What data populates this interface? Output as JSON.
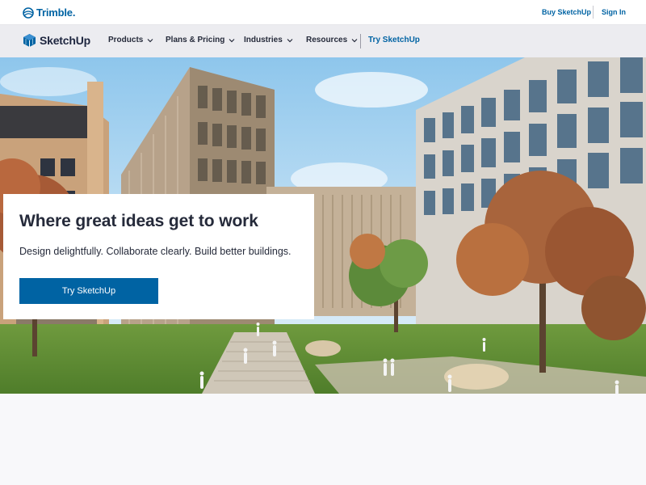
{
  "topbar": {
    "brand": "Trimble.",
    "buy_link": "Buy SketchUp",
    "signin_link": "Sign In"
  },
  "navbar": {
    "brand": "SketchUp",
    "items": [
      {
        "label": "Products"
      },
      {
        "label": "Plans & Pricing"
      },
      {
        "label": "Industries"
      },
      {
        "label": "Resources"
      }
    ],
    "try_link": "Try SketchUp"
  },
  "hero": {
    "title": "Where great ideas get to work",
    "subtitle": "Design delightfully. Collaborate clearly. Build better buildings.",
    "cta_label": "Try SketchUp",
    "image_icon": "campus-rendering-illustration"
  },
  "colors": {
    "brand_blue": "#0063a3",
    "text_dark": "#252a3a",
    "nav_bg": "#ececf0",
    "page_bg": "#f8f8fa"
  }
}
